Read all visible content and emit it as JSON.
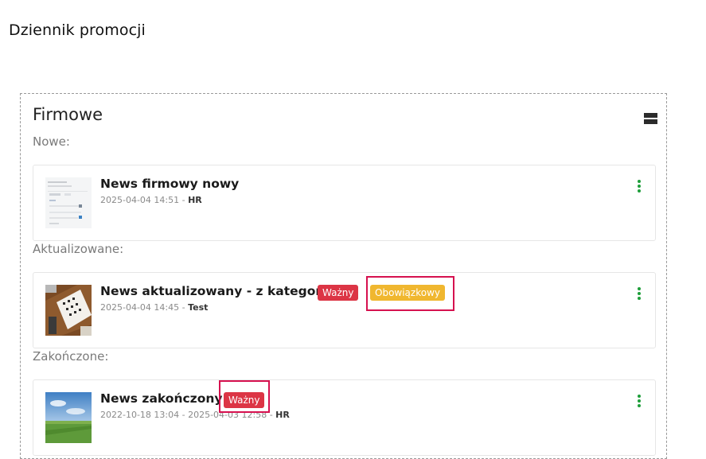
{
  "page": {
    "title": "Dziennik promocji"
  },
  "panel": {
    "title": "Firmowe",
    "collapse_icon": "collapse-rows-icon",
    "sections": [
      {
        "label": "Nowe:",
        "items": [
          {
            "title": "News firmowy nowy",
            "meta_date": "2025-04-04 14:51 - ",
            "meta_author": "HR",
            "badges": []
          }
        ]
      },
      {
        "label": "Aktualizowane:",
        "items": [
          {
            "title": "News aktualizowany - z kategorią",
            "meta_date": "2025-04-04 14:45 - ",
            "meta_author": "Test",
            "badges": [
              {
                "label": "Ważny",
                "color": "#dc3545"
              },
              {
                "label": "Obowiązkowy",
                "color": "#f0b72f"
              }
            ]
          }
        ]
      },
      {
        "label": "Zakończone:",
        "items": [
          {
            "title": "News zakończony",
            "meta_date": "2022-10-18 13:04 - 2025-04-03 12:58 - ",
            "meta_author": "HR",
            "badges": [
              {
                "label": "Ważny",
                "color": "#dc3545"
              }
            ]
          }
        ]
      }
    ]
  },
  "colors": {
    "highlight": "#d6114f",
    "kebab": "#1e9e3a",
    "badge_red": "#dc3545",
    "badge_yellow": "#f0b72f"
  }
}
